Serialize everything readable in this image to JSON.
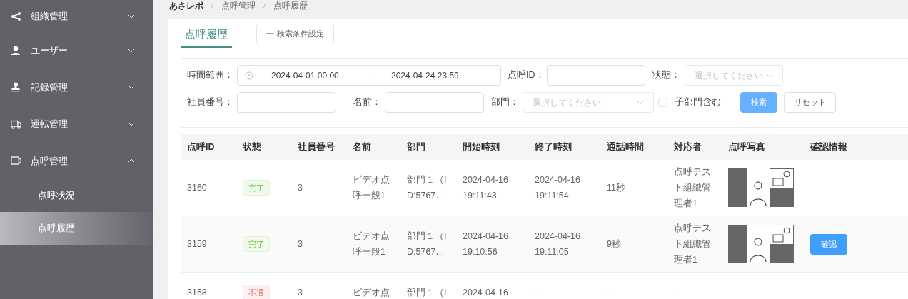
{
  "sidebar": {
    "items": [
      {
        "label": "組織管理",
        "expanded": false
      },
      {
        "label": "ユーザー",
        "expanded": false
      },
      {
        "label": "記録管理",
        "expanded": false
      },
      {
        "label": "運転管理",
        "expanded": false
      },
      {
        "label": "点呼管理",
        "expanded": true,
        "children": [
          {
            "label": "点呼状況",
            "selected": false
          },
          {
            "label": "点呼履歴",
            "selected": true
          }
        ]
      }
    ]
  },
  "breadcrumb": [
    "あさレポ",
    "点呼管理",
    "点呼履歴"
  ],
  "tabs": [
    {
      "label": "点呼履歴",
      "selected": true
    }
  ],
  "search_settings_button": {
    "icon": "一",
    "label": "検索条件設定"
  },
  "filters": {
    "time_range": {
      "label": "時間範囲：",
      "start": "2024-04-01 00:00",
      "separator": "-",
      "end": "2024-04-24 23:59"
    },
    "call_id": {
      "label": "点呼ID："
    },
    "status": {
      "label": "状態：",
      "placeholder": "選択してください"
    },
    "employee_no": {
      "label": "社員番号："
    },
    "name": {
      "label": "名前："
    },
    "department": {
      "label": "部門：",
      "placeholder": "選択してください"
    },
    "include_sub": {
      "label": "子部門含む",
      "checked": false
    },
    "buttons": [
      {
        "label": "検索",
        "kind": "primary"
      },
      {
        "label": "リセット",
        "kind": "default"
      }
    ]
  },
  "table": {
    "columns": [
      "点呼ID",
      "状態",
      "社員番号",
      "名前",
      "部門",
      "開始時刻",
      "終了時刻",
      "通話時間",
      "対応者",
      "点呼写真",
      "確認情報"
    ],
    "rows": [
      {
        "id": "3160",
        "status": {
          "label": "完了",
          "kind": "success"
        },
        "employee_no": "3",
        "name": "ビデオ点呼一般1",
        "department": "部門１（ID:5767…",
        "start": "2024-04-16 19:11:43",
        "end": "2024-04-16 19:11:54",
        "duration": "11秒",
        "responder": "点呼テスト組織管理者1",
        "photo": true
      },
      {
        "id": "3159",
        "status": {
          "label": "完了",
          "kind": "success"
        },
        "employee_no": "3",
        "name": "ビデオ点呼一般1",
        "department": "部門１（ID:5767…",
        "start": "2024-04-16 19:10:56",
        "end": "2024-04-16 19:11:05",
        "duration": "9秒",
        "responder": "点呼テスト組織管理者1",
        "photo": true,
        "confirm_button": "確認"
      },
      {
        "id": "3158",
        "status": {
          "label": "不通",
          "kind": "danger"
        },
        "employee_no": "3",
        "name": "ビデオ点",
        "department": "部門１（I",
        "start": "2024-04-16",
        "end": "-",
        "duration": "-",
        "responder": "-",
        "photo": false
      }
    ]
  }
}
